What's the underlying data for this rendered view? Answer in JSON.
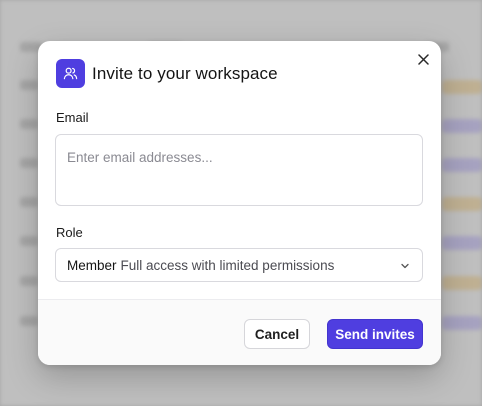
{
  "dialog": {
    "title": "Invite to your workspace",
    "close_icon": "close-icon",
    "header_icon": "users-icon"
  },
  "email": {
    "label": "Email",
    "placeholder": "Enter email addresses...",
    "value": ""
  },
  "role": {
    "label": "Role",
    "selected_name": "Member",
    "selected_description": "Full access with limited permissions",
    "chevron_icon": "chevron-down-icon"
  },
  "footer": {
    "cancel_label": "Cancel",
    "send_label": "Send invites"
  },
  "colors": {
    "accent": "#4f3ee0",
    "backdrop": "#c9c9c9"
  }
}
